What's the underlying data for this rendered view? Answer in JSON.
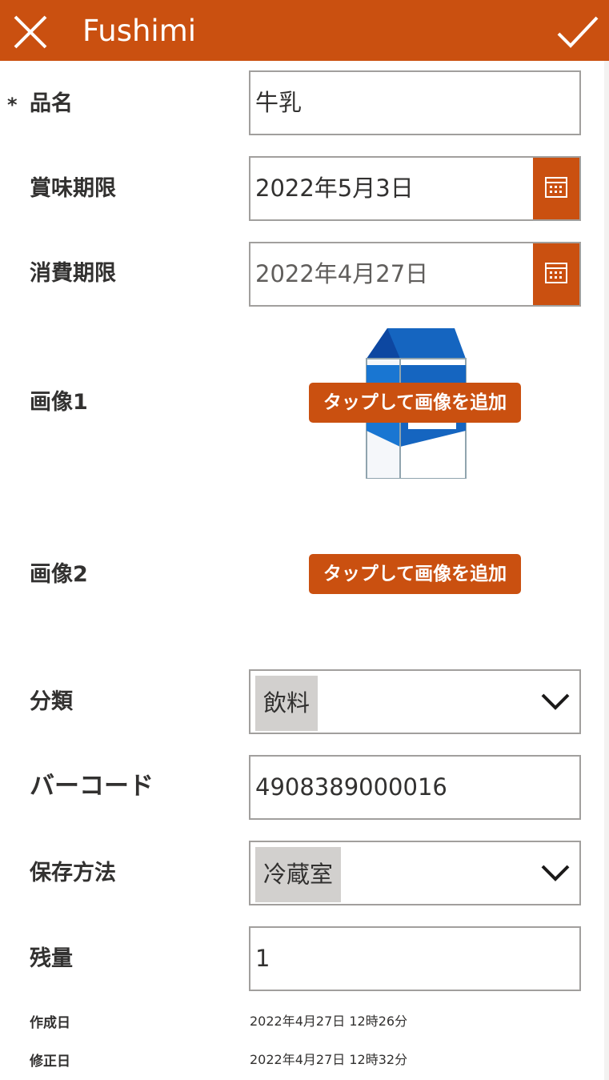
{
  "header": {
    "title": "Fushimi",
    "close_icon": "close-icon",
    "submit_icon": "checkmark-icon",
    "color": "#ca5010"
  },
  "form": {
    "required_marker": "*",
    "name": {
      "label": "品名",
      "value": "牛乳"
    },
    "best_before": {
      "label": "賞味期限",
      "value": "2022年5月3日"
    },
    "use_by": {
      "label": "消費期限",
      "value": "2022年4月27日"
    },
    "image1": {
      "label": "画像1",
      "button": "タップして画像を追加"
    },
    "image2": {
      "label": "画像2",
      "button": "タップして画像を追加"
    },
    "category": {
      "label": "分類",
      "value": "飲料"
    },
    "barcode": {
      "label": "バーコード",
      "value": "4908389000016"
    },
    "storage": {
      "label": "保存方法",
      "value": "冷蔵室"
    },
    "remaining": {
      "label": "残量",
      "value": "1"
    },
    "created": {
      "label": "作成日",
      "value": "2022年4月27日 12時26分"
    },
    "modified": {
      "label": "修正日",
      "value": "2022年4月27日 12時32分"
    }
  }
}
